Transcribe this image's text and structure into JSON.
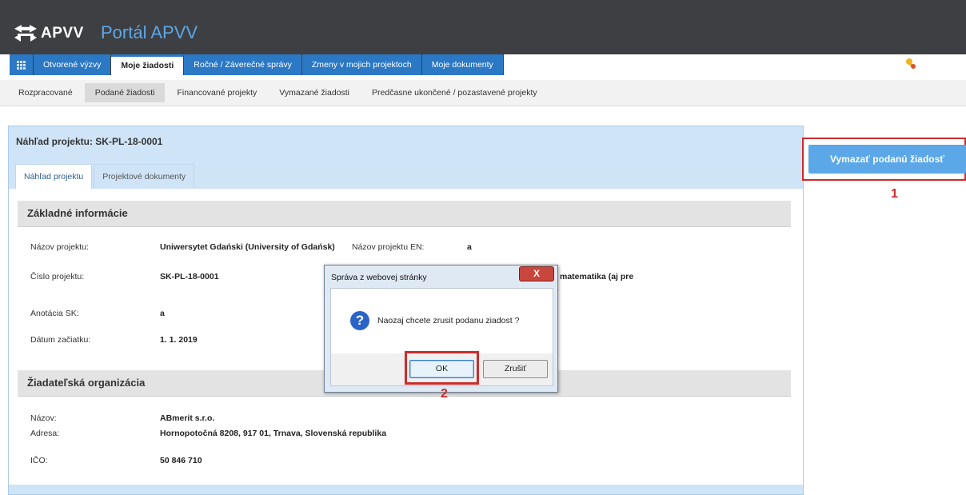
{
  "header": {
    "logo_text": "APVV",
    "portal_title": "Portál APVV",
    "change_password": "Zmena hesla"
  },
  "nav": {
    "items": [
      "Otvorené výzvy",
      "Moje žiadosti",
      "Ročné / Záverečné správy",
      "Zmeny v mojich projektoch",
      "Moje dokumenty"
    ],
    "active_index": 1
  },
  "subnav": {
    "items": [
      "Rozpracované",
      "Podané žiadosti",
      "Financované projekty",
      "Vymazané žiadosti",
      "Predčasne ukončené / pozastavené projekty"
    ],
    "active_index": 1
  },
  "panel": {
    "title": "Náhľad projektu: SK-PL-18-0001",
    "tabs": [
      "Náhľad projektu",
      "Projektové dokumenty"
    ]
  },
  "basic_info": {
    "header": "Základné informácie",
    "project_name_label": "Názov projektu:",
    "project_name_value": "Uniwersytet Gdański (University of Gdańsk)",
    "project_name_en_label": "Názov projektu EN:",
    "project_name_en_value": "a",
    "project_number_label": "Číslo projektu:",
    "project_number_value": "SK-PL-18-0001",
    "field_value_partial": "matematika (aj pre",
    "annotation_label": "Anotácia SK:",
    "annotation_value": "a",
    "start_date_label": "Dátum začiatku:",
    "start_date_value": "1. 1. 2019"
  },
  "organization": {
    "header": "Žiadateľská organizácia",
    "name_label": "Názov:",
    "name_value": "ABmerit s.r.o.",
    "address_label": "Adresa:",
    "address_value": "Hornopotočná 8208, 917 01, Trnava, Slovenská republika",
    "ico_label": "IČO:",
    "ico_value": "50 846 710"
  },
  "actions": {
    "delete_submitted": "Vymazať podanú žiadosť",
    "marker_1": "1",
    "marker_2": "2"
  },
  "dialog": {
    "title": "Správa z webovej stránky",
    "close_label": "X",
    "icon": "?",
    "message": "Naozaj chcete zrusit podanu ziadost ?",
    "ok_label": "OK",
    "cancel_label": "Zrušiť"
  },
  "colors": {
    "header_bg": "#3e3f42",
    "nav_blue": "#2b78c5",
    "accent_blue": "#5ba7e8",
    "panel_blue": "#cfe4f7",
    "highlight_red": "#cc2b2b"
  }
}
